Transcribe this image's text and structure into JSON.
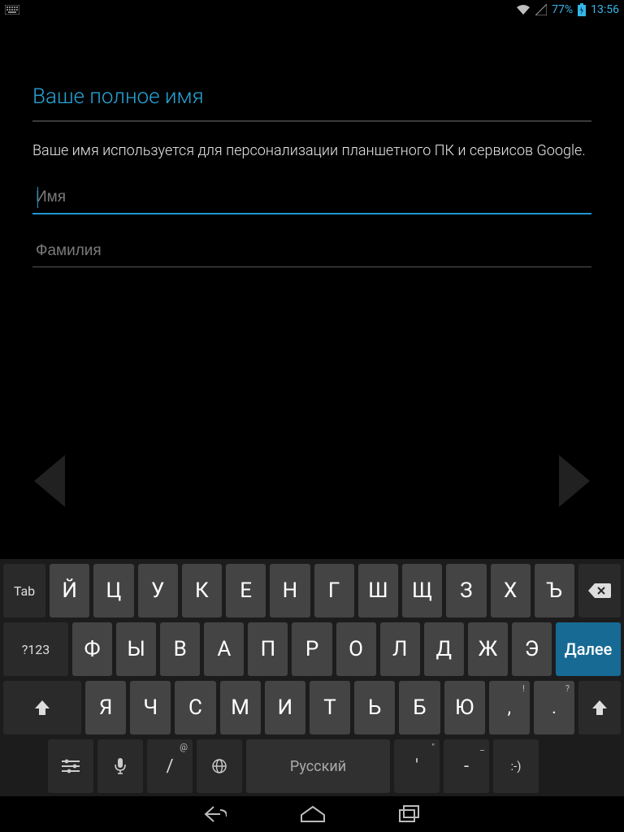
{
  "status": {
    "battery_pct": "77%",
    "time": "13:56"
  },
  "form": {
    "title": "Ваше полное имя",
    "description": "Ваше имя используется для персонализации планшетного ПК и сервисов Google.",
    "first_placeholder": "Имя",
    "first_value": "",
    "last_placeholder": "Фамилия",
    "last_value": ""
  },
  "keyboard": {
    "tab": "Tab",
    "sym": "?123",
    "next": "Далее",
    "space": "Русский",
    "row1": [
      "Й",
      "Ц",
      "У",
      "К",
      "Е",
      "Н",
      "Г",
      "Ш",
      "Щ",
      "З",
      "Х",
      "Ъ"
    ],
    "row2": [
      "Ф",
      "Ы",
      "В",
      "А",
      "П",
      "Р",
      "О",
      "Л",
      "Д",
      "Ж",
      "Э"
    ],
    "row3": [
      "Я",
      "Ч",
      "С",
      "М",
      "И",
      "Т",
      "Ь",
      "Б",
      "Ю",
      ",",
      "."
    ],
    "row4_slash": "/",
    "row4_slash_sup": "@",
    "row4_apos": "'",
    "row4_apos_sup": "\"",
    "row4_dash": "-",
    "row4_dash_sup": "_",
    "row4_smile": ":-)"
  }
}
